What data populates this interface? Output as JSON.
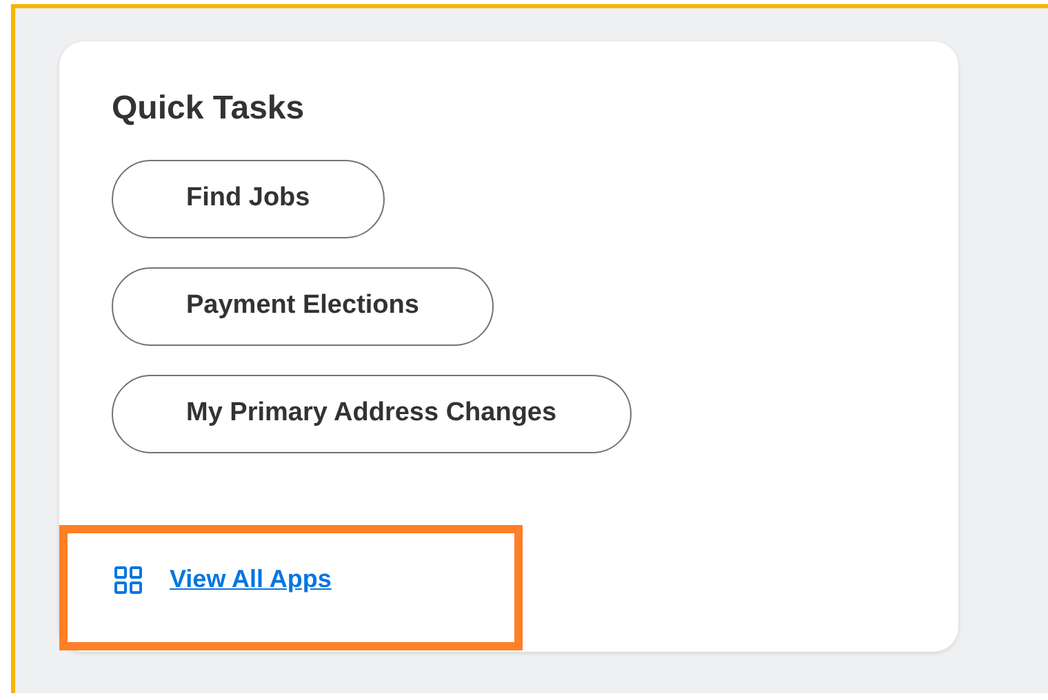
{
  "quick_tasks": {
    "title": "Quick Tasks",
    "tasks": [
      {
        "label": "Find Jobs"
      },
      {
        "label": "Payment Elections"
      },
      {
        "label": "My Primary Address Changes"
      }
    ],
    "link": {
      "label": "View All Apps"
    }
  }
}
